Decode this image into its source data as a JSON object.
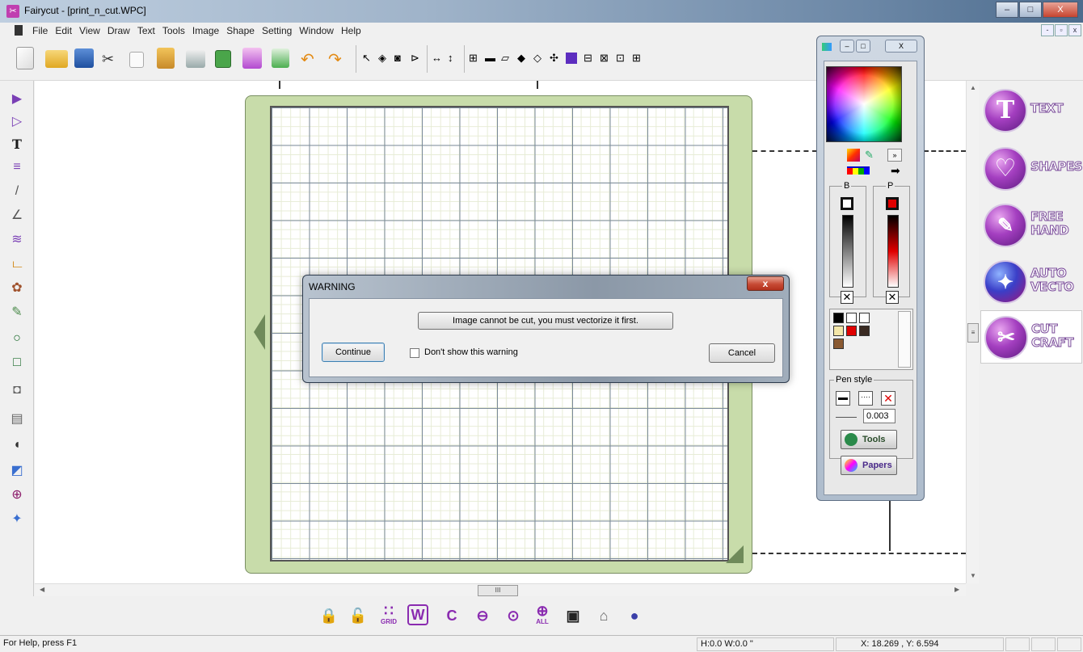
{
  "window": {
    "title": "Fairycut - [print_n_cut.WPC]",
    "controls": [
      "–",
      "□",
      "X"
    ],
    "mdi_controls": [
      "-",
      "▫",
      "x"
    ]
  },
  "menu": {
    "items": [
      "File",
      "Edit",
      "View",
      "Draw",
      "Text",
      "Tools",
      "Image",
      "Shape",
      "Setting",
      "Window",
      "Help"
    ]
  },
  "toolbar": {
    "icons": [
      "new-icon",
      "open-icon",
      "save-icon",
      "cut-icon",
      "copy-icon",
      "paste-icon",
      "print-icon",
      "refresh-icon",
      "library-icon",
      "import-icon",
      "undo-icon",
      "redo-icon"
    ],
    "tools": [
      "select-icon",
      "node-icon",
      "fill-icon",
      "split-icon",
      "flip-h-icon",
      "flip-v-icon",
      "group-icon",
      "rect-icon",
      "eraser-icon",
      "weld-icon",
      "shadow-icon",
      "center-icon",
      "color-icon",
      "align-icon",
      "align2-icon",
      "align3-icon",
      "align4-icon"
    ]
  },
  "toolbox": {
    "tools": [
      {
        "name": "select-arrow-icon",
        "glyph": "▶"
      },
      {
        "name": "node-edit-icon",
        "glyph": "▷"
      },
      {
        "name": "text-tool-icon",
        "glyph": "T"
      },
      {
        "name": "text-on-path-icon",
        "glyph": "≡"
      },
      {
        "name": "line-tool-icon",
        "glyph": "/"
      },
      {
        "name": "pen-tool-icon",
        "glyph": "∠"
      },
      {
        "name": "wave-tool-icon",
        "glyph": "≋"
      },
      {
        "name": "spiral-tool-icon",
        "glyph": "ட"
      },
      {
        "name": "stamp-tool-icon",
        "glyph": "✿"
      },
      {
        "name": "pencil-tool-icon",
        "glyph": "✎"
      },
      {
        "name": "ellipse-tool-icon",
        "glyph": "○"
      },
      {
        "name": "rectangle-tool-icon",
        "glyph": "□"
      },
      {
        "name": "fill-tool-icon",
        "glyph": "◘"
      },
      {
        "name": "image-tool-icon",
        "glyph": "▤"
      },
      {
        "name": "knife-tool-icon",
        "glyph": "◖"
      },
      {
        "name": "eraser-tool-icon",
        "glyph": "◩"
      },
      {
        "name": "zoom-in-tool-icon",
        "glyph": "⊕"
      },
      {
        "name": "magic-wand-tool-icon",
        "glyph": "✦"
      }
    ]
  },
  "right_panel": {
    "items": [
      {
        "name": "text-panel-item",
        "glyph": "T",
        "label": "TEXT"
      },
      {
        "name": "shapes-panel-item",
        "glyph": "♡",
        "label": "SHAPES"
      },
      {
        "name": "free-hand-panel-item",
        "glyph": "✎",
        "label": "FREE HAND"
      },
      {
        "name": "auto-vecto-panel-item",
        "glyph": "✦",
        "label": "AUTO VECTO"
      },
      {
        "name": "cut-craft-panel-item",
        "glyph": "✂",
        "label": "CUT CRAFT"
      }
    ]
  },
  "bottom_toolbar": {
    "items": [
      {
        "name": "lock-icon",
        "glyph": "🔒",
        "label": ""
      },
      {
        "name": "unlock-icon",
        "glyph": "🔓",
        "label": ""
      },
      {
        "name": "grid-icon",
        "glyph": "∷",
        "label": "GRID"
      },
      {
        "name": "weld-w-icon",
        "glyph": "W",
        "label": ""
      },
      {
        "name": "contour-c-icon",
        "glyph": "C",
        "label": ""
      },
      {
        "name": "zoom-out-icon",
        "glyph": "⊖",
        "label": ""
      },
      {
        "name": "zoom-selection-icon",
        "glyph": "⊙",
        "label": ""
      },
      {
        "name": "zoom-all-icon",
        "glyph": "⊕",
        "label": "ALL"
      },
      {
        "name": "preview-icon",
        "glyph": "▣",
        "label": ""
      },
      {
        "name": "machine-icon",
        "glyph": "⌂",
        "label": ""
      },
      {
        "name": "globe-icon",
        "glyph": "●",
        "label": ""
      }
    ]
  },
  "palette": {
    "buttons": [
      "»"
    ],
    "labels": {
      "border": "B",
      "pen": "P"
    },
    "swatches": [
      "#000000",
      "#ffffff",
      "#ffffff",
      "#ffffff",
      "#f3e6a8",
      "#e00000",
      "#3a2a22",
      "#8a5a32"
    ],
    "pen_style_label": "Pen style",
    "pen_width": "0.003",
    "tools_label": "Tools",
    "papers_label": "Papers"
  },
  "dialog": {
    "title": "WARNING",
    "message": "Image cannot be cut, you must vectorize it first.",
    "continue_label": "Continue",
    "checkbox_label": "Don't show this warning",
    "cancel_label": "Cancel"
  },
  "status_bar": {
    "help": "For Help, press F1",
    "dims": "H:0.0  W:0.0 \"",
    "coords": "X: 18.269 , Y: 6.594"
  }
}
